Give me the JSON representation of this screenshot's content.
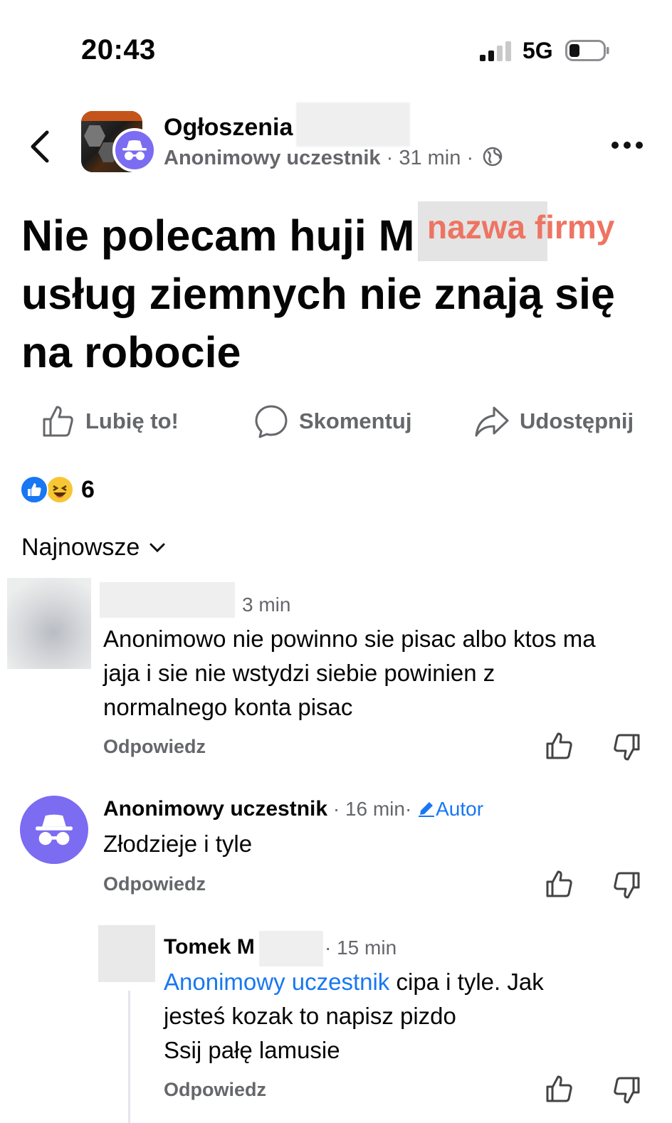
{
  "status_bar": {
    "time": "20:43",
    "network": "5G"
  },
  "header": {
    "group_name": "Ogłoszenia",
    "author": "Anonimowy uczestnik",
    "time": "31 min"
  },
  "post": {
    "text_line1": "Nie polecam huji M",
    "text_line2": "usług ziemnych nie znają się",
    "text_line3": "na  robocie",
    "redaction_watermark": "nazwa firmy"
  },
  "actions": {
    "like": "Lubię to!",
    "comment": "Skomentuj",
    "share": "Udostępnij"
  },
  "reactions": {
    "count": "6"
  },
  "sort": {
    "label": "Najnowsze"
  },
  "comments": [
    {
      "time": "3 min",
      "line1": "Anonimowo nie powinno sie pisac albo ktos ma",
      "line2": "jaja i sie nie wstydzi siebie powinien z",
      "line3": "normalnego konta pisac",
      "reply": "Odpowiedz"
    },
    {
      "name": "Anonimowy uczestnik",
      "time": "16 min",
      "badge": "Autor",
      "text": "Złodzieje i tyle",
      "reply": "Odpowiedz"
    },
    {
      "name": "Tomek M",
      "time": "15 min",
      "mention": "Anonimowy uczestnik",
      "line1_rest": " cipa i tyle. Jak",
      "line2": "jesteś kozak to napisz pizdo",
      "line3": "Ssij pałę  lamusie",
      "reply": "Odpowiedz"
    }
  ],
  "colors": {
    "accent": "#1877f2",
    "anon_avatar": "#7b6cf2",
    "watermark": "#ee7462",
    "secondary_text": "#65676b"
  }
}
